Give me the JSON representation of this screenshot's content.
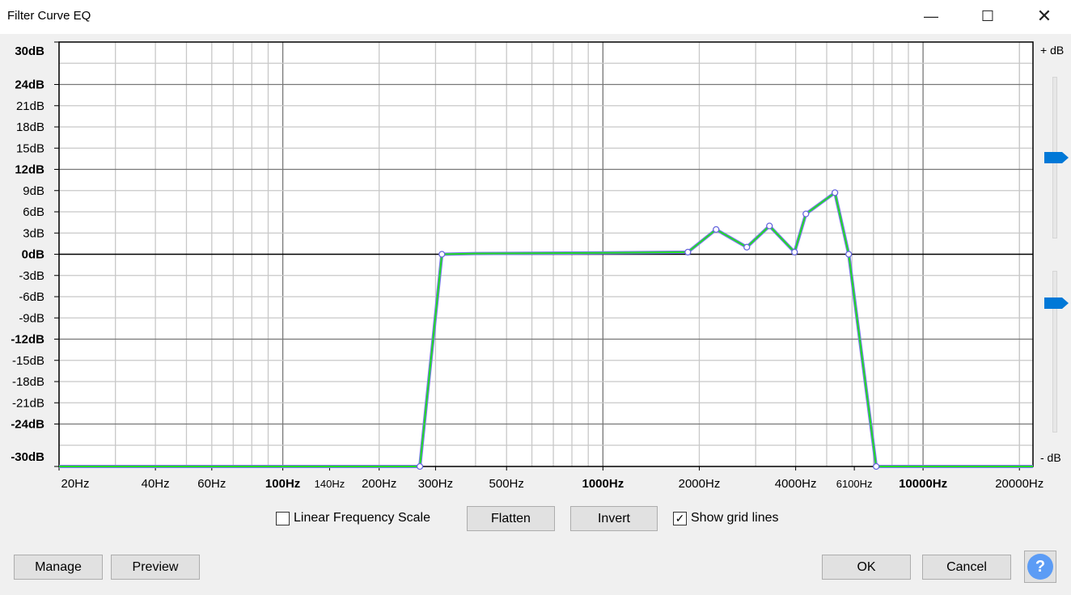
{
  "window": {
    "title": "Filter Curve EQ",
    "minimize_icon": "minimize-icon",
    "maximize_icon": "maximize-icon",
    "close_icon": "close-icon"
  },
  "chart_data": {
    "type": "line",
    "x_scale": "log",
    "xlim": [
      20,
      22050
    ],
    "ylim": [
      -30,
      30
    ],
    "grid": true,
    "y_ticks": [
      {
        "v": 30,
        "label": "30dB",
        "bold": true
      },
      {
        "v": 24,
        "label": "24dB",
        "bold": true
      },
      {
        "v": 21,
        "label": "21dB"
      },
      {
        "v": 18,
        "label": "18dB"
      },
      {
        "v": 15,
        "label": "15dB"
      },
      {
        "v": 12,
        "label": "12dB",
        "bold": true
      },
      {
        "v": 9,
        "label": "9dB"
      },
      {
        "v": 6,
        "label": "6dB"
      },
      {
        "v": 3,
        "label": "3dB"
      },
      {
        "v": 0,
        "label": "0dB",
        "bold": true
      },
      {
        "v": -3,
        "label": "-3dB"
      },
      {
        "v": -6,
        "label": "-6dB"
      },
      {
        "v": -9,
        "label": "-9dB"
      },
      {
        "v": -12,
        "label": "-12dB",
        "bold": true
      },
      {
        "v": -15,
        "label": "-15dB"
      },
      {
        "v": -18,
        "label": "-18dB"
      },
      {
        "v": -21,
        "label": "-21dB"
      },
      {
        "v": -24,
        "label": "-24dB",
        "bold": true
      },
      {
        "v": -30,
        "label": "-30dB",
        "bold": true
      }
    ],
    "x_ticks": [
      {
        "v": 20,
        "label": "20Hz"
      },
      {
        "v": 40,
        "label": "40Hz"
      },
      {
        "v": 60,
        "label": "60Hz"
      },
      {
        "v": 100,
        "label": "100Hz",
        "bold": true
      },
      {
        "v": 140,
        "label": "140Hz",
        "small": true
      },
      {
        "v": 200,
        "label": "200Hz"
      },
      {
        "v": 300,
        "label": "300Hz"
      },
      {
        "v": 500,
        "label": "500Hz"
      },
      {
        "v": 1000,
        "label": "1000Hz",
        "bold": true
      },
      {
        "v": 2000,
        "label": "2000Hz"
      },
      {
        "v": 4000,
        "label": "4000Hz"
      },
      {
        "v": 6100,
        "label": "6100Hz",
        "small": true
      },
      {
        "v": 10000,
        "label": "10000Hz",
        "bold": true
      },
      {
        "v": 20000,
        "label": "20000Hz"
      }
    ],
    "series": [
      {
        "points": [
          [
            20,
            -30
          ],
          [
            268,
            -30
          ],
          [
            314,
            0
          ],
          [
            400,
            0.1
          ],
          [
            1000,
            0.2
          ],
          [
            1842,
            0.3
          ],
          [
            2257,
            3.5
          ],
          [
            2815,
            1
          ],
          [
            3313,
            4
          ],
          [
            3968,
            0.3
          ],
          [
            4305,
            5.7
          ],
          [
            5305,
            8.7
          ],
          [
            5859,
            0
          ],
          [
            7138,
            -30
          ],
          [
            22050,
            -30
          ]
        ],
        "control_points": [
          [
            268,
            -30
          ],
          [
            314,
            0
          ],
          [
            1842,
            0.3
          ],
          [
            2257,
            3.5
          ],
          [
            2815,
            1
          ],
          [
            3313,
            4
          ],
          [
            3968,
            0.3
          ],
          [
            4305,
            5.7
          ],
          [
            5305,
            8.7
          ],
          [
            5859,
            0
          ],
          [
            7138,
            -30
          ]
        ]
      }
    ],
    "colors": {
      "curve": "#22dd22",
      "curve_shadow": "#7777ee",
      "point": "#6666dd"
    }
  },
  "sliders": {
    "plus_label": "+ dB",
    "minus_label": "- dB",
    "max_gain_fraction": 0.5,
    "min_gain_fraction": 0.2,
    "accent": "#0078d7"
  },
  "controls": {
    "linear_scale_label": "Linear Frequency Scale",
    "linear_scale_checked": false,
    "flatten": "Flatten",
    "invert": "Invert",
    "grid_label": "Show grid lines",
    "grid_checked": true
  },
  "footer": {
    "manage": "Manage",
    "preview": "Preview",
    "ok": "OK",
    "cancel": "Cancel",
    "help": "?"
  }
}
